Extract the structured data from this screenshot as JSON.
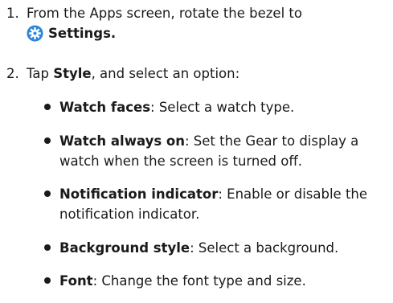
{
  "colors": {
    "text": "#1a1a1a",
    "gear_icon": "#2f86d8"
  },
  "steps": [
    {
      "number": "1.",
      "text": "From the Apps screen, rotate the bezel to",
      "icon": "settings-gear-icon",
      "bold": "Settings",
      "suffix": "."
    },
    {
      "number": "2.",
      "prefix": "Tap ",
      "bold": "Style",
      "suffix": ", and select an option:"
    }
  ],
  "bullets": [
    {
      "bold": "Watch faces",
      "text": ": Select a watch type."
    },
    {
      "bold": "Watch always on",
      "text": ": Set the Gear to display a watch when the screen is turned off."
    },
    {
      "bold": "Notification indicator",
      "text": ": Enable or disable the notification indicator."
    },
    {
      "bold": "Background style",
      "text": ": Select a background."
    },
    {
      "bold": "Font",
      "text": ": Change the font type and size."
    }
  ]
}
